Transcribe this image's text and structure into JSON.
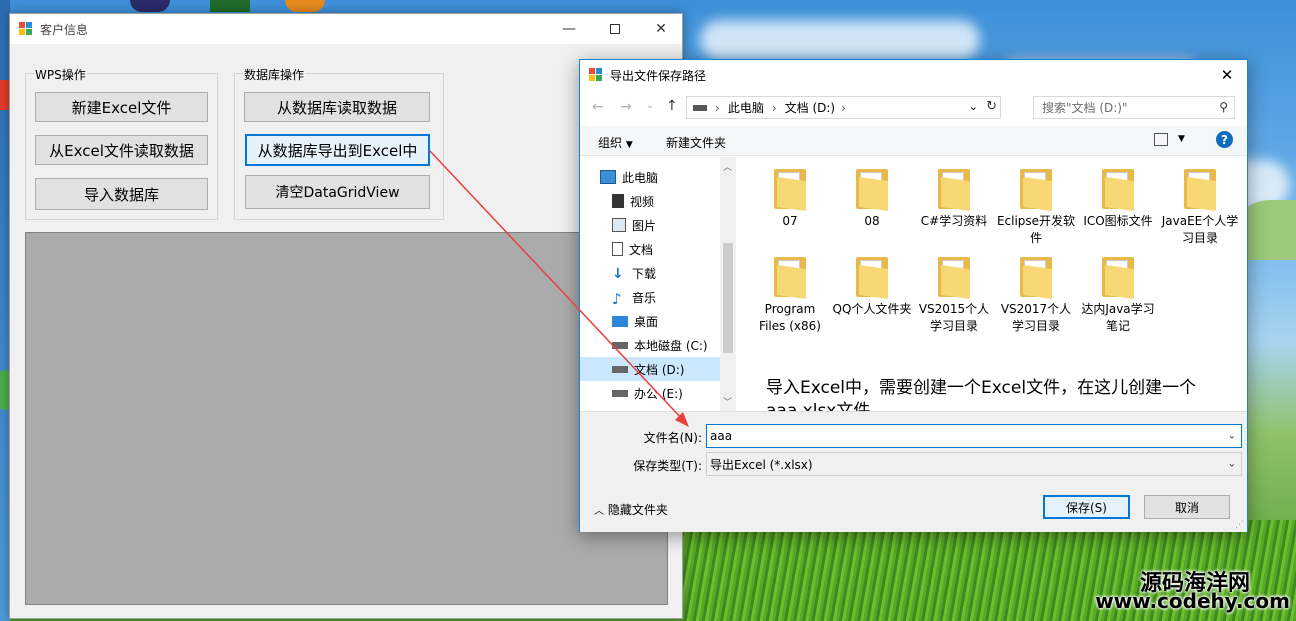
{
  "main_window": {
    "title": "客户信息",
    "wps_group_label": "WPS操作",
    "db_group_label": "数据库操作",
    "buttons": {
      "new_excel": "新建Excel文件",
      "read_excel": "从Excel文件读取数据",
      "import_db": "导入数据库",
      "read_db": "从数据库读取数据",
      "export_excel": "从数据库导出到Excel中",
      "clear_grid": "清空DataGridView"
    }
  },
  "dialog": {
    "title": "导出文件保存路径",
    "breadcrumb": [
      "此电脑",
      "文档 (D:)"
    ],
    "search_placeholder": "搜索\"文档 (D:)\"",
    "toolbar": {
      "organize": "组织",
      "new_folder": "新建文件夹"
    },
    "tree": [
      {
        "label": "此电脑",
        "icon": "computer-icon"
      },
      {
        "label": "视频",
        "icon": "video-icon"
      },
      {
        "label": "图片",
        "icon": "picture-icon"
      },
      {
        "label": "文档",
        "icon": "document-icon"
      },
      {
        "label": "下载",
        "icon": "download-icon"
      },
      {
        "label": "音乐",
        "icon": "music-icon"
      },
      {
        "label": "桌面",
        "icon": "desktop-icon"
      },
      {
        "label": "本地磁盘 (C:)",
        "icon": "drive-icon"
      },
      {
        "label": "文档 (D:)",
        "icon": "drive-icon"
      },
      {
        "label": "办公 (E:)",
        "icon": "drive-icon"
      }
    ],
    "folders": [
      {
        "name": "07"
      },
      {
        "name": "08"
      },
      {
        "name": "C#学习资料"
      },
      {
        "name": "Eclipse开发软件"
      },
      {
        "name": "ICO图标文件"
      },
      {
        "name": "JavaEE个人学习目录"
      },
      {
        "name": "Program Files (x86)"
      },
      {
        "name": "QQ个人文件夹"
      },
      {
        "name": "VS2015个人学习目录"
      },
      {
        "name": "VS2017个人学习目录"
      },
      {
        "name": "达内Java学习笔记"
      }
    ],
    "annotation": "导入Excel中，需要创建一个Excel文件，在这儿创建一个aaa.xlsx文件。",
    "filename_label": "文件名(N):",
    "filename_value": "aaa",
    "filetype_label": "保存类型(T):",
    "filetype_value": "导出Excel (*.xlsx)",
    "hide_folders": "隐藏文件夹",
    "save_button": "保存(S)",
    "cancel_button": "取消"
  },
  "watermark": {
    "line1": "源码海洋网",
    "line2": "www.codehy.com"
  },
  "colors": {
    "accent": "#0078d7",
    "arrow": "#e8413c",
    "grid_bg": "#ababab"
  }
}
